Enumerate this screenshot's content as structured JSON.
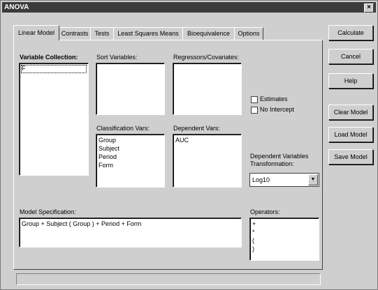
{
  "window": {
    "title": "ANOVA",
    "close_glyph": "×"
  },
  "tabs": [
    {
      "label": "Linear Model",
      "active": true
    },
    {
      "label": "Contrasts"
    },
    {
      "label": "Tests"
    },
    {
      "label": "Least Squares Means"
    },
    {
      "label": "Bioequivalence"
    },
    {
      "label": "Options"
    }
  ],
  "labels": {
    "variable_collection": "Variable Collection:",
    "sort_variables": "Sort Variables:",
    "regressors": "Regressors/Covariates:",
    "classification": "Classification Vars:",
    "dependent": "Dependent Vars:",
    "estimates": "Estimates",
    "no_intercept": "No Intercept",
    "transformation": "Dependent Variables Transformation:",
    "model_spec": "Model Specification:",
    "operators": "Operators:"
  },
  "variable_collection": [
    "F"
  ],
  "classification_vars": [
    "Group",
    "Subject",
    "Period",
    "Form"
  ],
  "dependent_vars": [
    "AUC"
  ],
  "transformation": {
    "selected": "Log10"
  },
  "model_specification": "Group + Subject ( Group ) + Period + Form",
  "operators": [
    "+",
    "*",
    "(",
    ")"
  ],
  "buttons": {
    "calculate": "Calculate",
    "cancel": "Cancel",
    "help": "Help",
    "clear_model": "Clear Model",
    "load_model": "Load Model",
    "save_model": "Save Model"
  }
}
